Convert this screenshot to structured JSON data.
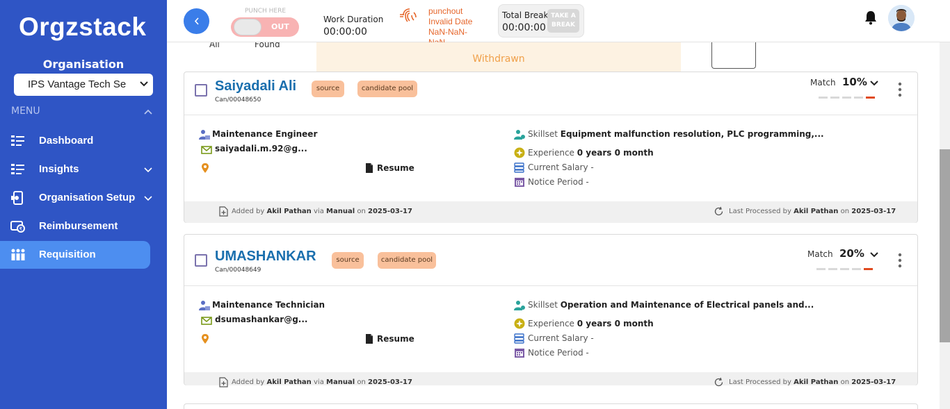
{
  "sidebar": {
    "logo": "Orgzstack",
    "org_label": "Organisation",
    "org_selected": "IPS Vantage Tech Se",
    "menu_label": "MENU",
    "items": [
      {
        "label": "Dashboard",
        "icon": "dashboard-icon"
      },
      {
        "label": "Insights",
        "icon": "insights-icon"
      },
      {
        "label": "Organisation Setup",
        "icon": "organisation-setup-icon"
      },
      {
        "label": "Reimbursement",
        "icon": "reimbursement-icon"
      },
      {
        "label": "Requisition",
        "icon": "requisition-icon"
      }
    ]
  },
  "header": {
    "back_icon": "chevron-left-icon",
    "punch_here": "PUNCH HERE",
    "punch_out": "OUT",
    "work_duration_label": "Work Duration",
    "work_duration_value": "00:00:00",
    "punchout_lines": [
      "punchout",
      "Invalid Date",
      "NaN-NaN-",
      "NaN"
    ],
    "total_break_label": "Total Break",
    "total_break_value": "00:00:00",
    "take_break_lines": [
      "TAKE A",
      "BREAK"
    ]
  },
  "prev_card": {
    "all_label": "All",
    "found_label": "Found",
    "withdrawn_label": "Withdrawn"
  },
  "candidates": [
    {
      "name": "Saiyadali Ali",
      "id": "Can/00048650",
      "tags": [
        "source",
        "candidate pool"
      ],
      "match_label": "Match",
      "match": "10%",
      "match_fraction": 0.1,
      "role": "Maintenance Engineer",
      "email": "saiyadali.m.92@g...",
      "resume_label": "Resume",
      "skillset_label": "Skillset",
      "skillset": "Equipment malfunction resolution, PLC programming,...",
      "experience_label": "Experience",
      "experience": "0 years 0 month",
      "salary_label": "Current Salary",
      "salary": "-",
      "notice_label": "Notice Period",
      "notice": "-",
      "added_prefix": "Added by",
      "added_by": "Akil Pathan",
      "via": "via",
      "source": "Manual",
      "on": "on",
      "added_date": "2025-03-17",
      "processed_prefix": "Last Processed by",
      "processed_by": "Akil Pathan",
      "processed_date": "2025-03-17"
    },
    {
      "name": "UMASHANKAR",
      "id": "Can/00048649",
      "tags": [
        "source",
        "candidate pool"
      ],
      "match_label": "Match",
      "match": "20%",
      "match_fraction": 0.2,
      "role": "Maintenance Technician",
      "email": "dsumashankar@g...",
      "resume_label": "Resume",
      "skillset_label": "Skillset",
      "skillset": "Operation and Maintenance of Electrical panels and...",
      "experience_label": "Experience",
      "experience": "0 years 0 month",
      "salary_label": "Current Salary",
      "salary": "-",
      "notice_label": "Notice Period",
      "notice": "-",
      "added_prefix": "Added by",
      "added_by": "Akil Pathan",
      "via": "via",
      "source": "Manual",
      "on": "on",
      "added_date": "2025-03-17",
      "processed_prefix": "Last Processed by",
      "processed_by": "Akil Pathan",
      "processed_date": "2025-03-17"
    }
  ],
  "colors": {
    "sidebar": "#2f55c5",
    "active_nav": "#4d8ef0",
    "name": "#1a6fae",
    "tag": "#f9c09b",
    "accent_orange": "#e6662b"
  }
}
